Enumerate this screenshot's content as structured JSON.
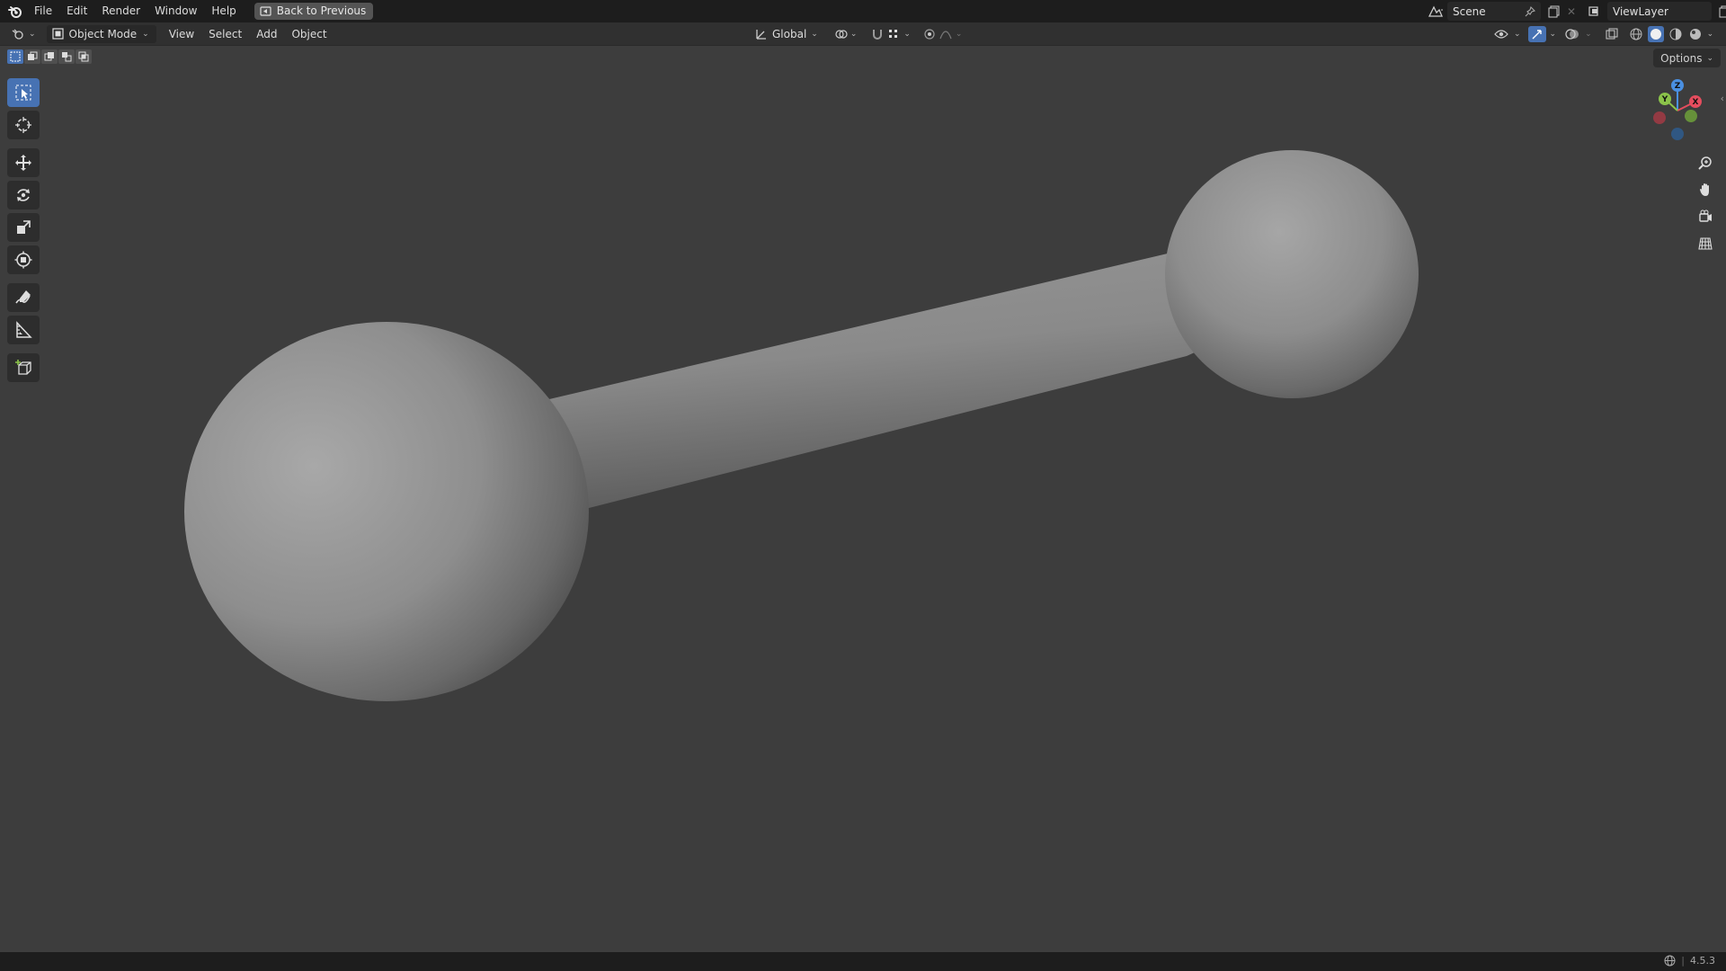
{
  "topbar": {
    "menus": [
      "File",
      "Edit",
      "Render",
      "Window",
      "Help"
    ],
    "back_button": "Back to Previous",
    "scene": "Scene",
    "view_layer": "ViewLayer"
  },
  "header": {
    "mode": "Object Mode",
    "menus": [
      "View",
      "Select",
      "Add",
      "Object"
    ],
    "orientation": "Global"
  },
  "viewport": {
    "options": "Options",
    "gizmo_axes": [
      "X",
      "Y",
      "Z"
    ]
  },
  "status": {
    "version": "4.5.3"
  },
  "colors": {
    "accent": "#4772b3",
    "axis_x": "#e54d5e",
    "axis_y": "#8bc34a",
    "axis_z": "#4a90e2"
  }
}
